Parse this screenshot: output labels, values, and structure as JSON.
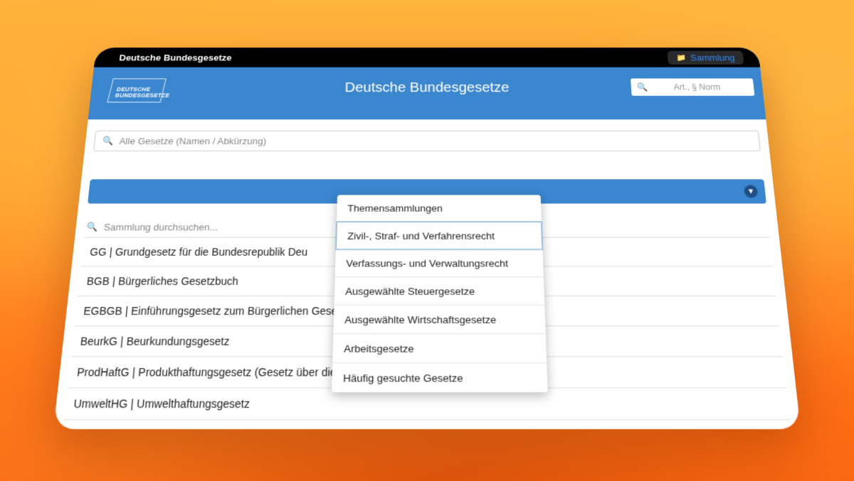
{
  "window": {
    "title": "Deutsche Bundesgesetze",
    "sammlung_button": "Sammlung",
    "sammlung_icon": "folder-icon"
  },
  "header": {
    "logo_line1": "DEUTSCHE",
    "logo_line2": "BUNDESGESETZE",
    "title": "Deutsche Bundesgesetze",
    "search_placeholder": "Art., § Norm"
  },
  "main": {
    "law_search_placeholder": "Alle Gesetze (Namen / Abkürzung)",
    "collection_search_placeholder": "Sammlung durchsuchen...",
    "laws": [
      "GG | Grundgesetz für die Bundesrepublik Deu",
      "BGB | Bürgerliches Gesetzbuch",
      "EGBGB | Einführungsgesetz zum Bürgerlichen Gesetzbuche",
      "BeurkG | Beurkundungsgesetz",
      "ProdHaftG | Produkthaftungsgesetz (Gesetz über die Haftung für fehlerhafte Produkte)",
      "UmweltHG | Umwelthaftungsgesetz"
    ]
  },
  "dropdown": {
    "items": [
      "Themensammlungen",
      "Zivil-, Straf- und Verfahrensrecht",
      "Verfassungs- und Verwaltungsrecht",
      "Ausgewählte Steuergesetze",
      "Ausgewählte Wirtschaftsgesetze",
      "Arbeitsgesetze",
      "Häufig gesuchte Gesetze"
    ],
    "selected_index": 1
  },
  "colors": {
    "primary": "#3a86cf",
    "titlebar": "#000000",
    "accent_link": "#2f8cff"
  }
}
